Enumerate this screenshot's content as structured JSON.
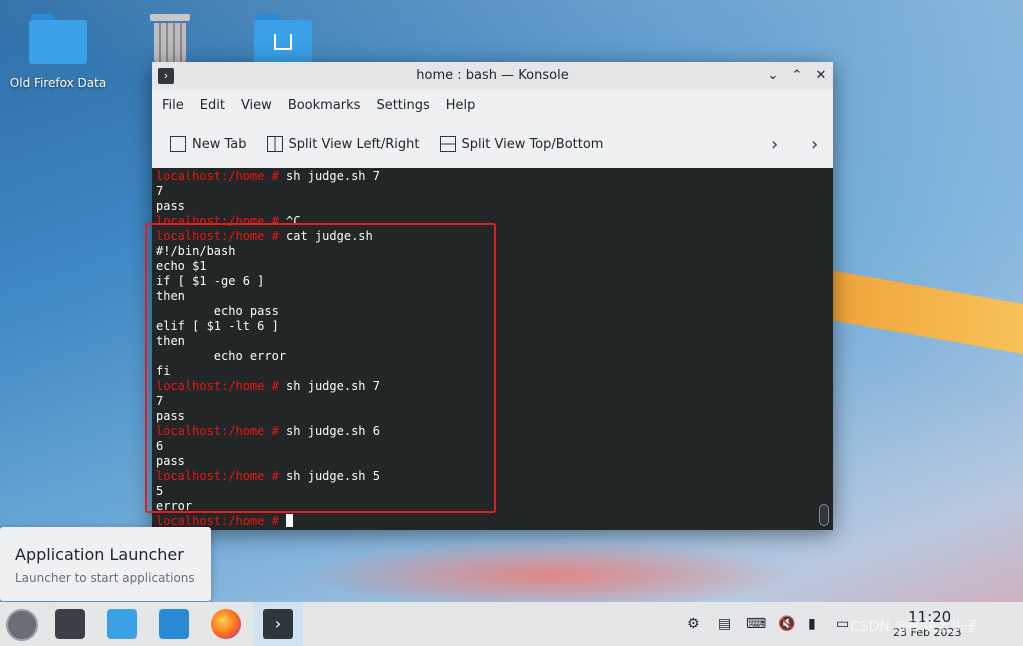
{
  "desktop": {
    "icons": [
      {
        "label": "Old Firefox Data"
      },
      {
        "label": ""
      },
      {
        "label": ""
      }
    ]
  },
  "window": {
    "title": "home : bash — Konsole",
    "menu": [
      "File",
      "Edit",
      "View",
      "Bookmarks",
      "Settings",
      "Help"
    ],
    "toolbar": {
      "new_tab": "New Tab",
      "split_lr": "Split View Left/Right",
      "split_tb": "Split View Top/Bottom"
    }
  },
  "terminal": {
    "lines": [
      {
        "prompt": "localhost:/home #",
        "text": " sh judge.sh 7"
      },
      {
        "prompt": "",
        "text": "7"
      },
      {
        "prompt": "",
        "text": "pass"
      },
      {
        "prompt": "localhost:/home #",
        "text": " ^C"
      },
      {
        "prompt": "localhost:/home #",
        "text": " cat judge.sh"
      },
      {
        "prompt": "",
        "text": "#!/bin/bash"
      },
      {
        "prompt": "",
        "text": "echo $1"
      },
      {
        "prompt": "",
        "text": "if [ $1 -ge 6 ]"
      },
      {
        "prompt": "",
        "text": "then"
      },
      {
        "prompt": "",
        "text": "        echo pass"
      },
      {
        "prompt": "",
        "text": "elif [ $1 -lt 6 ]"
      },
      {
        "prompt": "",
        "text": "then"
      },
      {
        "prompt": "",
        "text": "        echo error"
      },
      {
        "prompt": "",
        "text": "fi"
      },
      {
        "prompt": "localhost:/home #",
        "text": " sh judge.sh 7"
      },
      {
        "prompt": "",
        "text": "7"
      },
      {
        "prompt": "",
        "text": "pass"
      },
      {
        "prompt": "localhost:/home #",
        "text": " sh judge.sh 6"
      },
      {
        "prompt": "",
        "text": "6"
      },
      {
        "prompt": "",
        "text": "pass"
      },
      {
        "prompt": "localhost:/home #",
        "text": " sh judge.sh 5"
      },
      {
        "prompt": "",
        "text": "5"
      },
      {
        "prompt": "",
        "text": "error"
      },
      {
        "prompt": "localhost:/home #",
        "text": " "
      }
    ]
  },
  "tooltip": {
    "title": "Application Launcher",
    "subtitle": "Launcher to start applications"
  },
  "taskbar": {
    "time": "11:20",
    "date": "23 Feb 2023"
  },
  "watermark": "CSDN @砖块上头子",
  "colors": {
    "terminal_bg": "#232627",
    "prompt": "#ed1515",
    "highlight": "#e02020"
  }
}
